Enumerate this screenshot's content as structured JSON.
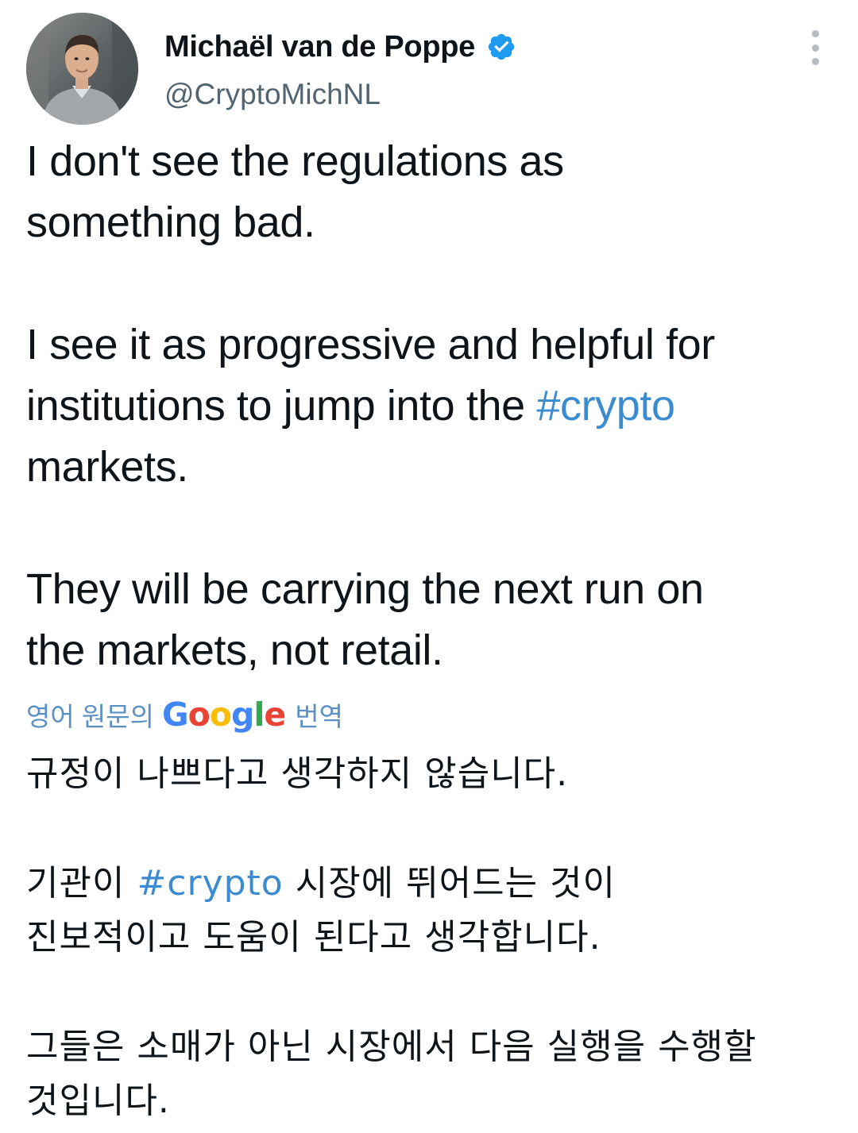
{
  "author": {
    "name": "Michaël van de Poppe",
    "handle": "@CryptoMichNL",
    "verified": true
  },
  "icons": {
    "avatar": "user-avatar-photo",
    "verified": "verified-badge-icon",
    "more": "more-options-vertical-icon"
  },
  "tweet": {
    "para1": {
      "line1": "I don't see the regulations as",
      "line2": "something bad."
    },
    "para2": {
      "line1": "I see it as progressive and helpful for",
      "line2_pre": "institutions to jump into the ",
      "line2_hashtag": "#crypto",
      "line3": "markets."
    },
    "para3": {
      "line1": "They will be carrying the next run on",
      "line2": "the markets, not retail."
    }
  },
  "translation": {
    "prefix": "영어 원문의",
    "brand": "Google",
    "suffix": "번역",
    "para1": {
      "line1": "규정이 나쁘다고 생각하지 않습니다."
    },
    "para2": {
      "line1_pre": " 기관이 ",
      "line1_hashtag": "#crypto",
      "line1_post": " 시장에 뛰어드는 것이",
      "line2": "진보적이고 도움이 된다고 생각합니다."
    },
    "para3": {
      "line1": " 그들은 소매가 아닌 시장에서 다음 실행을 수행할",
      "line2": "것입니다."
    }
  },
  "colors": {
    "text": "#0f1419",
    "secondary": "#536471",
    "link": "#3a8bd0",
    "verified": "#1d9bf0"
  }
}
